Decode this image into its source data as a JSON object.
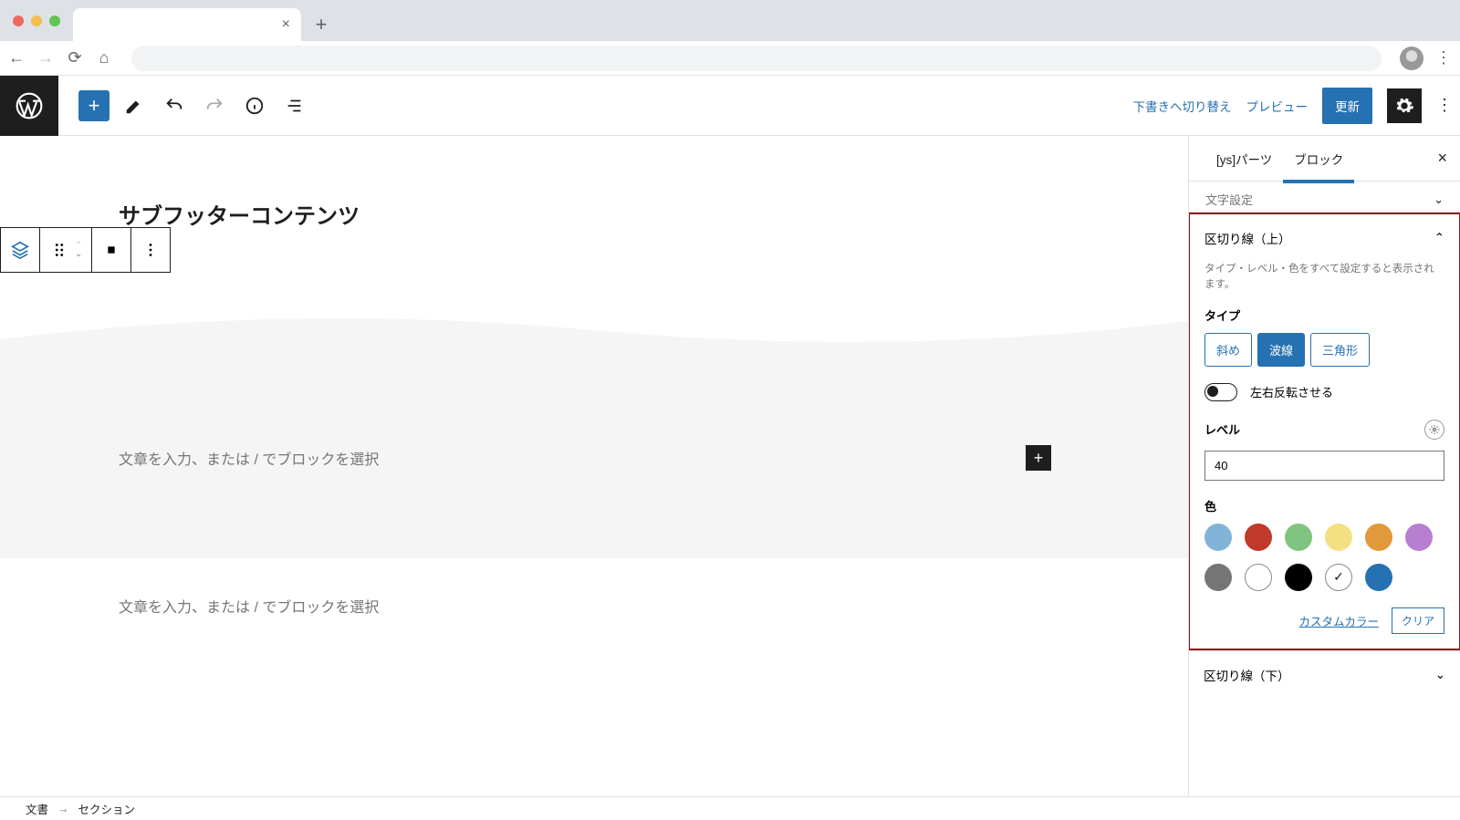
{
  "topbar": {
    "draft_switch": "下書きへ切り替え",
    "preview": "プレビュー",
    "update": "更新"
  },
  "canvas": {
    "title": "サブフッターコンテンツ",
    "placeholder1": "文章を入力、または / でブロックを選択",
    "placeholder2": "文章を入力、または / でブロックを選択"
  },
  "sidebar": {
    "tab1": "[ys]パーツ",
    "tab2": "ブロック",
    "cut_panel": "文字設定",
    "panel_top": {
      "title": "区切り線（上）",
      "note": "タイプ・レベル・色をすべて設定すると表示されます。",
      "type_label": "タイプ",
      "type_options": [
        "斜め",
        "波線",
        "三角形"
      ],
      "flip_label": "左右反転させる",
      "level_label": "レベル",
      "level_value": "40",
      "color_label": "色",
      "colors": [
        {
          "hex": "#82b4d8",
          "sel": false,
          "border": false
        },
        {
          "hex": "#c0392b",
          "sel": false,
          "border": false
        },
        {
          "hex": "#7fc47f",
          "sel": false,
          "border": false
        },
        {
          "hex": "#f3e083",
          "sel": false,
          "border": false
        },
        {
          "hex": "#e09a3c",
          "sel": false,
          "border": false
        },
        {
          "hex": "#b67fcf",
          "sel": false,
          "border": false
        },
        {
          "hex": "#757575",
          "sel": false,
          "border": false
        },
        {
          "hex": "#ffffff",
          "sel": false,
          "border": true
        },
        {
          "hex": "#000000",
          "sel": false,
          "border": false
        },
        {
          "hex": "#ffffff",
          "sel": true,
          "border": true
        },
        {
          "hex": "#2571b1",
          "sel": false,
          "border": false
        }
      ],
      "custom_color": "カスタムカラー",
      "clear": "クリア"
    },
    "panel_bottom": "区切り線（下）"
  },
  "breadcrumb": {
    "item1": "文書",
    "item2": "セクション"
  }
}
